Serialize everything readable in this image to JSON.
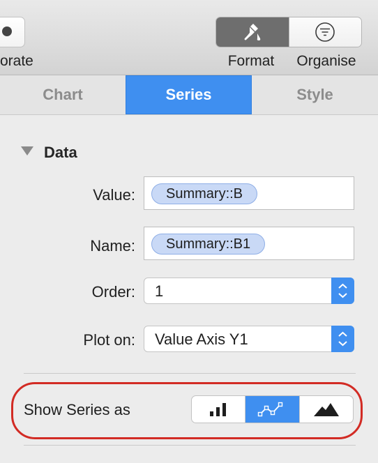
{
  "toolbar": {
    "collaborate_label": "orate",
    "format_label": "Format",
    "organise_label": "Organise",
    "active_tool": "format",
    "accent_color": "#6e6e6e",
    "icons": {
      "collaborate": "collaborate-icon",
      "format": "paintbrush-icon",
      "organise": "filter-icon"
    }
  },
  "tabs": [
    {
      "label": "Chart",
      "active": false
    },
    {
      "label": "Series",
      "active": true
    },
    {
      "label": "Style",
      "active": false
    }
  ],
  "data_section": {
    "title": "Data",
    "expanded": true,
    "value": {
      "label": "Value:",
      "token": "Summary::B"
    },
    "name": {
      "label": "Name:",
      "token": "Summary::B1"
    },
    "order": {
      "label": "Order:",
      "selected": "1"
    },
    "plot_on": {
      "label": "Plot on:",
      "selected": "Value Axis Y1"
    }
  },
  "show_series": {
    "label": "Show Series as",
    "options": [
      {
        "icon": "bar-chart-icon",
        "active": false
      },
      {
        "icon": "line-chart-icon",
        "active": true
      },
      {
        "icon": "area-chart-icon",
        "active": false
      }
    ],
    "highlight_color": "#d22b24"
  },
  "colors": {
    "accent": "#3f8ff0",
    "token_fill": "#c9d9f6",
    "token_border": "#8eaee6"
  }
}
